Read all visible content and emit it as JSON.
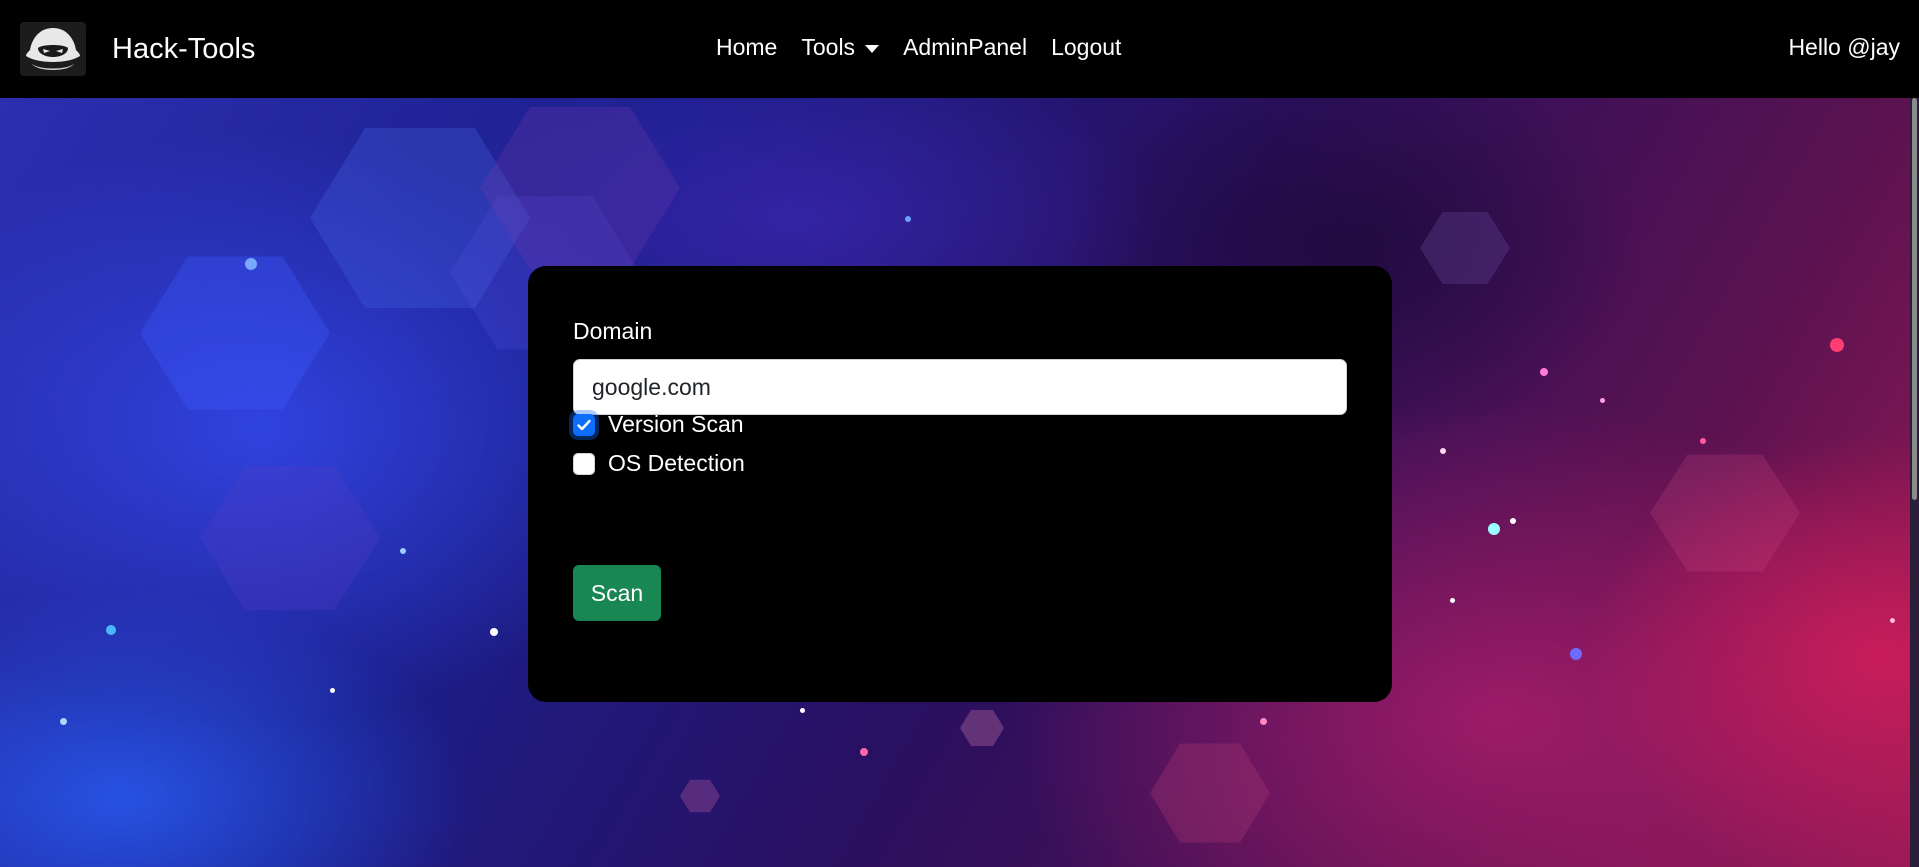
{
  "navbar": {
    "brand": "Hack-Tools",
    "logo_icon": "hacker-mask-icon",
    "links": [
      {
        "label": "Home"
      },
      {
        "label": "Tools",
        "icon": "caret-down-icon"
      },
      {
        "label": "AdminPanel"
      },
      {
        "label": "Logout"
      }
    ],
    "greeting": "Hello @jay"
  },
  "form": {
    "domain_label": "Domain",
    "domain_value": "google.com",
    "options": [
      {
        "label": "Version Scan",
        "checked": true
      },
      {
        "label": "OS Detection",
        "checked": false
      }
    ],
    "scan_button": "Scan"
  },
  "colors": {
    "navbar_bg": "#000000",
    "card_bg": "#000000",
    "checkbox_accent": "#0d6efd",
    "scan_button_bg": "#198754"
  }
}
